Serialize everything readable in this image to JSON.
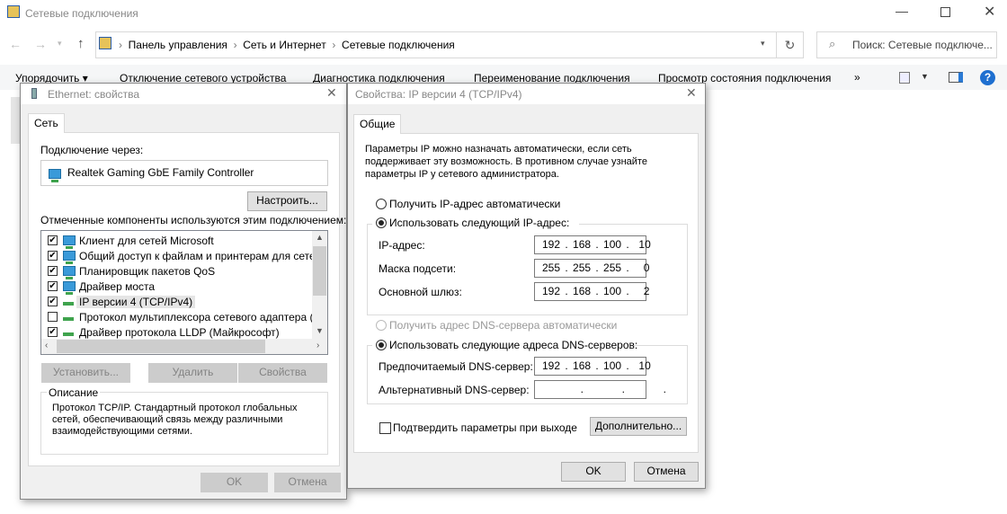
{
  "window": {
    "title": "Сетевые подключения",
    "breadcrumb": [
      "Панель управления",
      "Сеть и Интернет",
      "Сетевые подключения"
    ],
    "search_placeholder": "Поиск: Сетевые подключе..."
  },
  "toolbar": {
    "organize": "Упорядочить ▾",
    "items": [
      "Отключение сетевого устройства",
      "Диагностика подключения",
      "Переименование подключения",
      "Просмотр состояния подключения"
    ],
    "more": "»"
  },
  "eth": {
    "title": "Ethernet: свойства",
    "tab": "Сеть",
    "connect_via": "Подключение через:",
    "adapter": "Realtek Gaming GbE Family Controller",
    "configure": "Настроить...",
    "components_label": "Отмеченные компоненты используются этим подключением:",
    "components": [
      {
        "label": "Клиент для сетей Microsoft",
        "checked": true,
        "icon": "net"
      },
      {
        "label": "Общий доступ к файлам и принтерам для сетей Mi",
        "checked": true,
        "icon": "net"
      },
      {
        "label": "Планировщик пакетов QoS",
        "checked": true,
        "icon": "net"
      },
      {
        "label": "Драйвер моста",
        "checked": true,
        "icon": "net"
      },
      {
        "label": "IP версии 4 (TCP/IPv4)",
        "checked": true,
        "icon": "proto",
        "selected": true
      },
      {
        "label": "Протокол мультиплексора сетевого адаптера (Май",
        "checked": false,
        "icon": "proto"
      },
      {
        "label": "Драйвер протокола LLDP (Майкрософт)",
        "checked": true,
        "icon": "proto"
      }
    ],
    "install": "Установить...",
    "remove": "Удалить",
    "properties": "Свойства",
    "desc_title": "Описание",
    "desc_lines": [
      "Протокол TCP/IP. Стандартный протокол глобальных",
      "сетей, обеспечивающий связь между различными",
      "взаимодействующими сетями."
    ],
    "ok": "OK",
    "cancel": "Отмена"
  },
  "ipv4": {
    "title": "Свойства: IP версии 4 (TCP/IPv4)",
    "tab": "Общие",
    "intro": [
      "Параметры IP можно назначать автоматически, если сеть",
      "поддерживает эту возможность. В противном случае узнайте",
      "параметры IP у сетевого администратора."
    ],
    "auto_ip": "Получить IP-адрес автоматически",
    "manual_ip": "Использовать следующий IP-адрес:",
    "ip_label": "IP-адрес:",
    "ip": "192 . 168 . 100 .  10",
    "mask_label": "Маска подсети:",
    "mask": "255 . 255 . 255 .   0",
    "gw_label": "Основной шлюз:",
    "gw": "192 . 168 . 100 .   2",
    "auto_dns": "Получить адрес DNS-сервера автоматически",
    "manual_dns": "Использовать следующие адреса DNS-серверов:",
    "dns1_label": "Предпочитаемый DNS-сервер:",
    "dns1": "192 . 168 . 100 .  10",
    "dns2_label": "Альтернативный DNS-сервер:",
    "dns2": "        .        .        .",
    "validate": "Подтвердить параметры при выходе",
    "advanced": "Дополнительно...",
    "ok": "OK",
    "cancel": "Отмена"
  }
}
